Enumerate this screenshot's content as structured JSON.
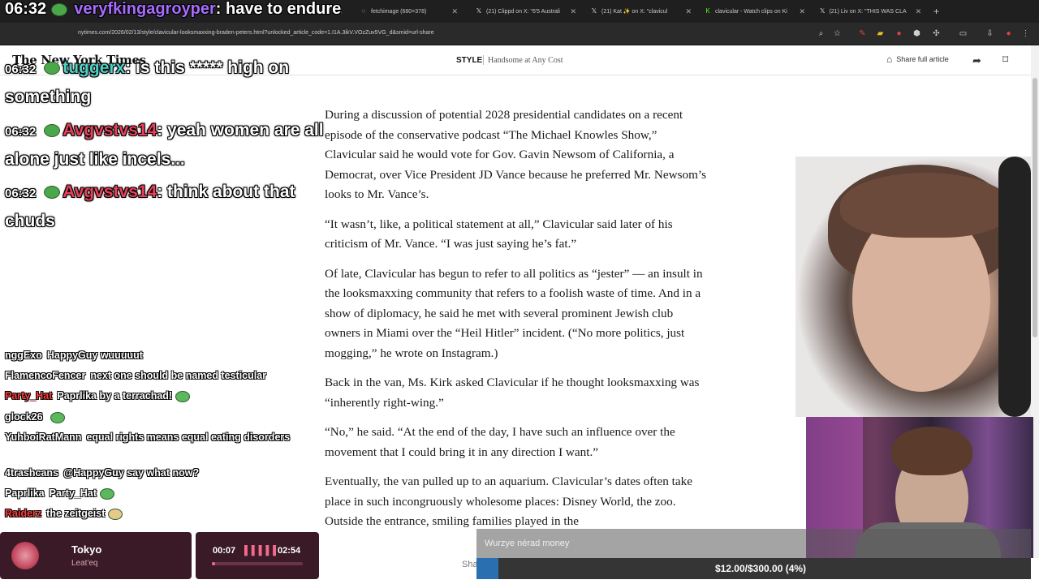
{
  "browser": {
    "tabs": [
      {
        "title": "veryfkingagroyper : have to"
      },
      {
        "title": "fetchimage (680×378)"
      },
      {
        "title": "(21) Clippd on X: \"6'5 Australi"
      },
      {
        "title": "(21) Kat ✨ on X: \"clavicul"
      },
      {
        "title": "clavicular - Watch clips on Ki"
      },
      {
        "title": "(21) Liv on X: \"THIS WAS CLA"
      }
    ],
    "url": "nytimes.com/2026/02/13/style/clavicular-looksmaxxing-braden-peters.html?unlocked_article_code=1.I1A.3ikV.VOzZuv5VG_d&smid=url-share"
  },
  "nyt": {
    "logo": "The New York Times",
    "section": "STYLE",
    "headline": "Handsome at Any Cost",
    "share_label": "Share full article"
  },
  "article": {
    "paragraphs": [
      "During a discussion of potential 2028 presidential candidates on a recent episode of the conservative podcast “The Michael Knowles Show,” Clavicular said he would vote for Gov. Gavin Newsom of California, a Democrat, over Vice President JD Vance because he preferred Mr. Newsom’s looks to Mr. Vance’s.",
      "“It wasn’t, like, a political statement at all,” Clavicular said later of his criticism of Mr. Vance. “I was just saying he’s fat.”",
      "Of late, Clavicular has begun to refer to all politics as “jester” — an insult in the looksmaxxing community that refers to a foolish waste of time. And in a show of diplomacy, he said he met with several prominent Jewish club owners in Miami over the “Heil Hitler” incident. (“No more politics, just mogging,” he wrote on Instagram.)",
      "Back in the van, Ms. Kirk asked Clavicular if he thought looksmaxxing was “inherently right-wing.”",
      "“No,” he said. “At the end of the day, I have such an influence over the movement that I could bring it in any direction I want.”",
      "Eventually, the van pulled up to an aquarium. Clavicular’s dates often take place in such incongruously wholesome places: Disney World, the zoo. Outside the entrance, smiling families played in the"
    ]
  },
  "chat_overlay": {
    "top": {
      "time": "06:32",
      "user": "veryfkingagroyper",
      "text": ": have to endure"
    },
    "big": [
      {
        "time": "06:32",
        "user": "tuggerx",
        "text": ": is this ***** high on something",
        "color": "#4fd1c5"
      },
      {
        "time": "06:32",
        "user": "Avgvstvs14",
        "text": ": yeah women are all alone just like incels...",
        "color": "#e8405a"
      },
      {
        "time": "06:32",
        "user": "Avgvstvs14",
        "text": ": think about that chuds",
        "color": "#e8405a"
      }
    ],
    "small": [
      {
        "user": "nggExo",
        "text": "HappyGuy wuuuuut",
        "color": "#ffffff"
      },
      {
        "user": "FlamencoFencer",
        "text": "next one should be named testicular",
        "color": "#ffffff"
      },
      {
        "user": "Party_Hat",
        "text": "Paprlika by a terrachad!",
        "color": "#ff3b3b"
      },
      {
        "user": "glock26",
        "text": "",
        "color": "#ffffff"
      },
      {
        "user": "YuhboiRatMann",
        "text": "equal rights means equal eating disorders",
        "color": "#ffffff"
      },
      {
        "user": "4trashcans",
        "text": "@HappyGuy say what now?",
        "color": "#ffffff"
      },
      {
        "user": "Paprlika",
        "text": "Party_Hat",
        "color": "#ffffff"
      },
      {
        "user": "Raiderz",
        "text": "the zeitgeist",
        "color": "#ff3b3b"
      }
    ]
  },
  "music": {
    "track": "Tokyo",
    "artist": "Leat'eq"
  },
  "timer": {
    "elapsed": "00:07",
    "wave": "▌▌▌▌▌",
    "total": "02:54",
    "progress": 0.04
  },
  "goal": {
    "text": "$12.00/$300.00 (4%)",
    "progress": 0.04
  },
  "ticker": {
    "text": "Wurzye nérad money"
  },
  "shared": {
    "label": "Shared"
  }
}
